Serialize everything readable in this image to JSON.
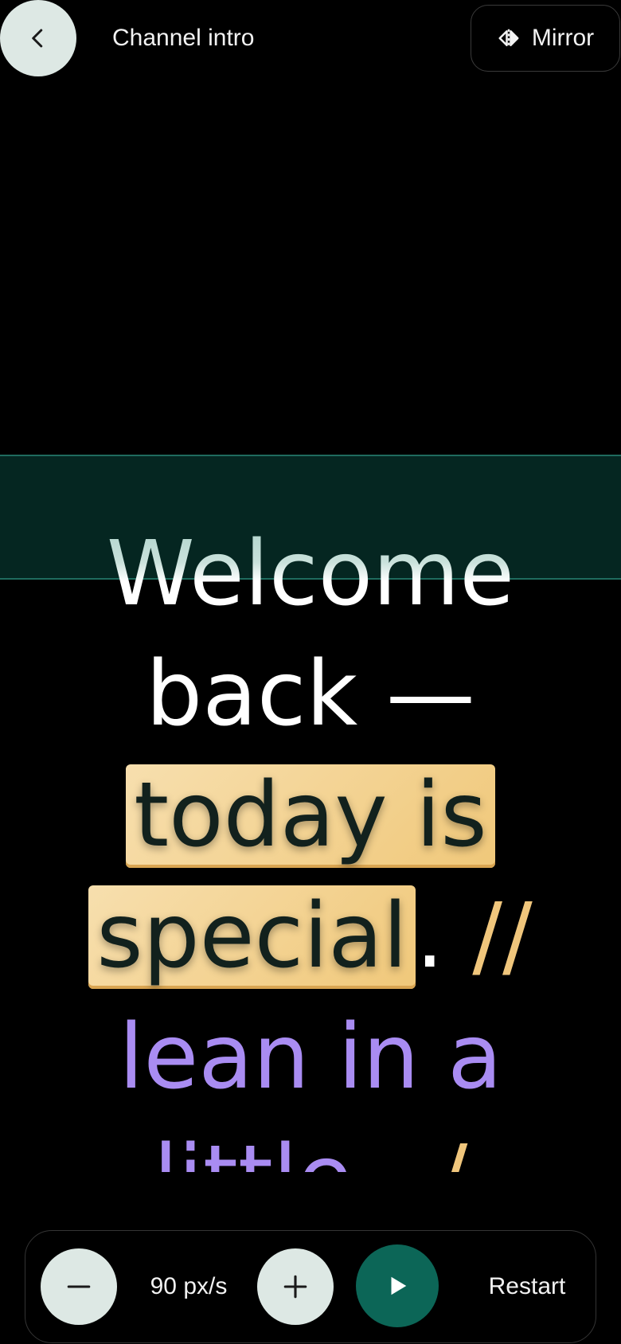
{
  "header": {
    "title": "Channel intro",
    "back_icon": "chevron-left-icon",
    "mirror_label": "Mirror",
    "mirror_icon": "mirror-flip-icon"
  },
  "script": {
    "line1": "Welcome",
    "line2": "back —",
    "line3_highlight": "today is",
    "line4_highlight": "special",
    "line4_punct": ".",
    "line4_comment": "//",
    "line5": "lean in a",
    "line6_aside": "little",
    "line6_comment": "/"
  },
  "controls": {
    "speed_value": "90 px/s",
    "decrease_icon": "minus-icon",
    "increase_icon": "plus-icon",
    "play_icon": "play-icon",
    "restart_label": "Restart"
  },
  "colors": {
    "accent": "#0c6657",
    "band": "#052621",
    "highlight": "#f0c87a",
    "comment": "#f0c67c",
    "aside": "#a98cf2",
    "button_bg": "#dde8e4"
  }
}
